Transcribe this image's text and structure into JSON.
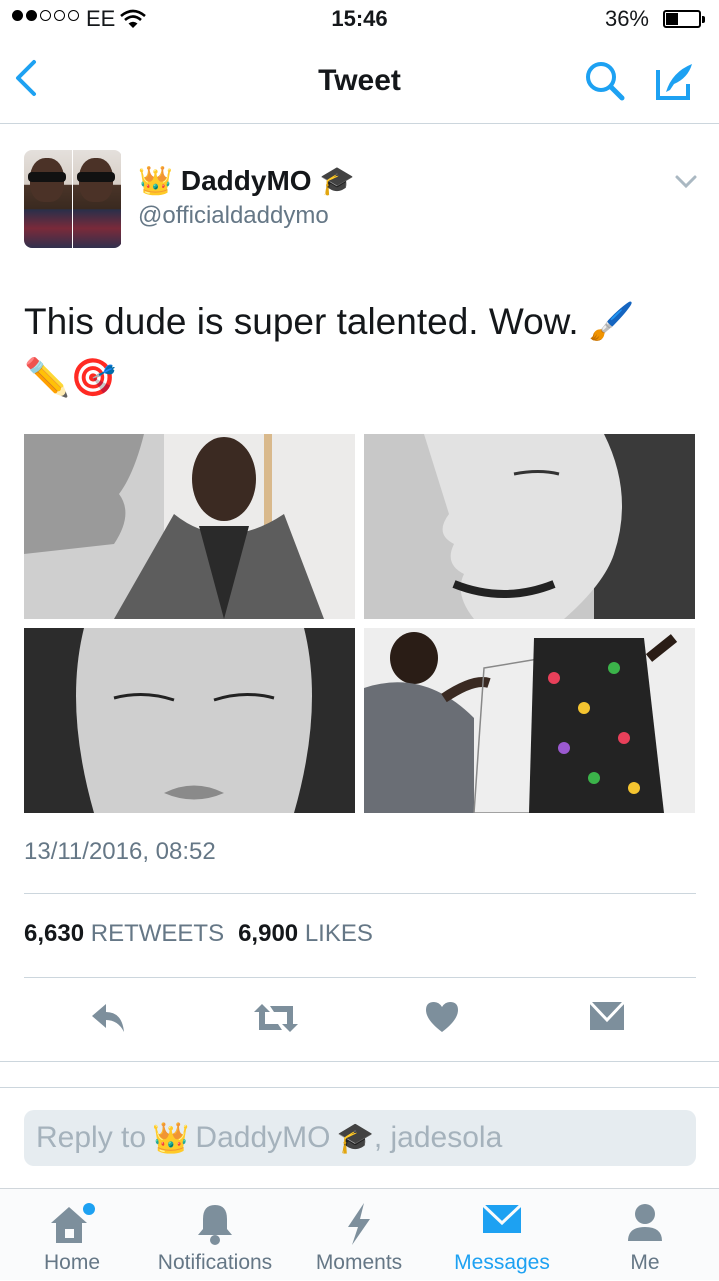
{
  "status_bar": {
    "carrier": "EE",
    "time": "15:46",
    "battery": "36%",
    "battery_level": 0.36
  },
  "nav": {
    "title": "Tweet"
  },
  "tweet": {
    "display_name": "DaddyMO",
    "name_prefix_emoji": "👑",
    "name_suffix_emoji": "🎓",
    "handle": "@officialdaddymo",
    "text": "This dude is super talented. Wow. 🖌️ ✏️🎯",
    "timestamp": "13/11/2016, 08:52",
    "retweets_count": "6,630",
    "retweets_label": "RETWEETS",
    "likes_count": "6,900",
    "likes_label": "LIKES"
  },
  "reply": {
    "prefix": "Reply to",
    "crown": "👑",
    "name": "DaddyMO",
    "cap": "🎓",
    "suffix": ", jadesola"
  },
  "tabs": [
    {
      "label": "Home",
      "icon": "home-icon"
    },
    {
      "label": "Notifications",
      "icon": "bell-icon"
    },
    {
      "label": "Moments",
      "icon": "lightning-icon"
    },
    {
      "label": "Messages",
      "icon": "envelope-icon"
    },
    {
      "label": "Me",
      "icon": "person-icon"
    }
  ],
  "colors": {
    "accent": "#1da1f2",
    "text": "#14171a",
    "secondary": "#657786",
    "icon_gray": "#7d8f9c"
  }
}
